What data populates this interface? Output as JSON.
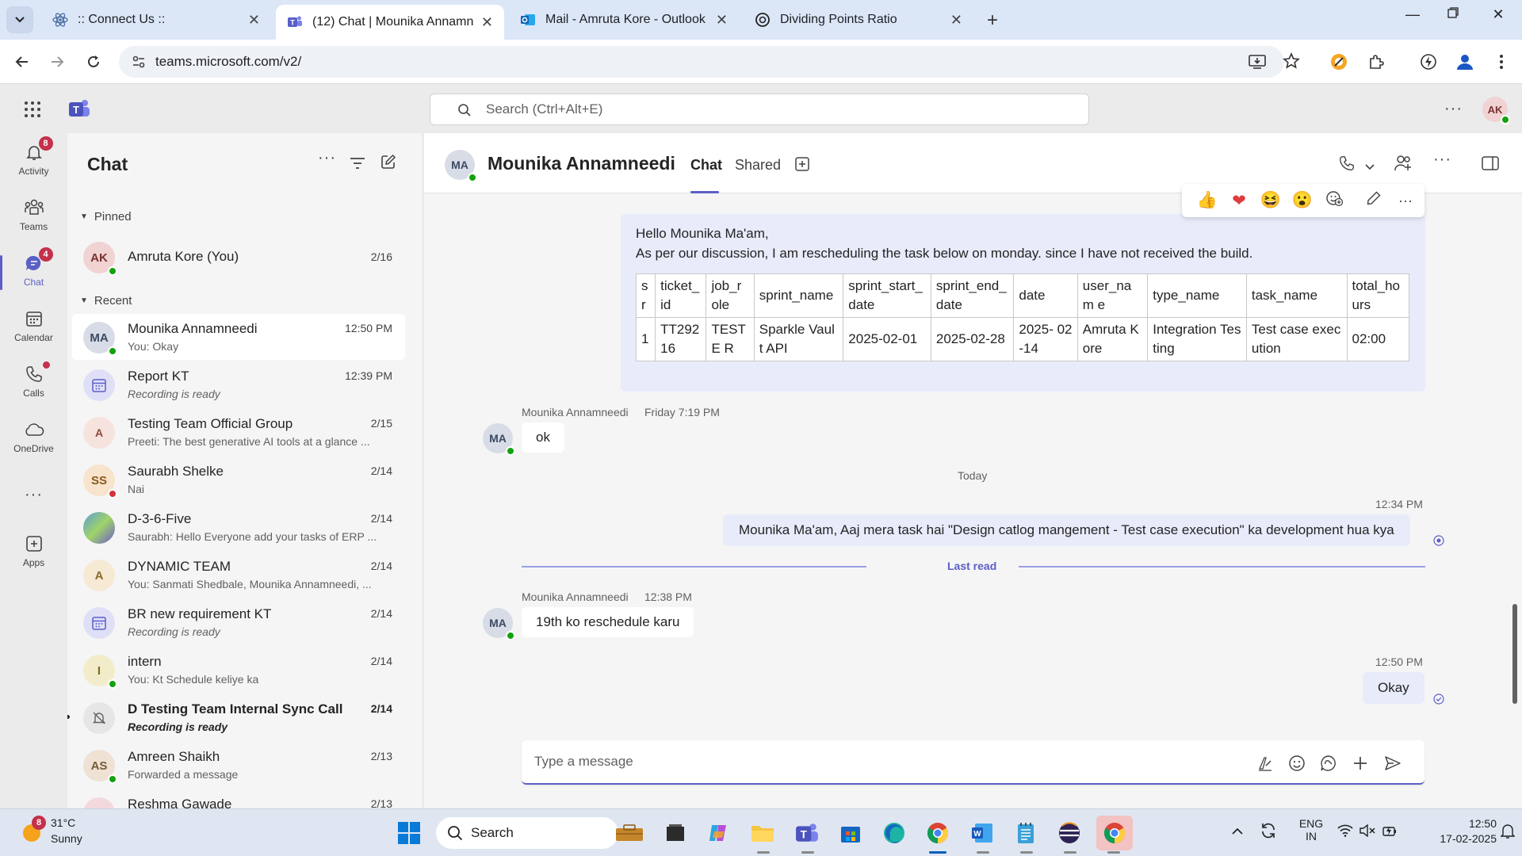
{
  "browser": {
    "tabs": [
      {
        "title": ":: Connect Us ::",
        "active": false
      },
      {
        "title": "(12) Chat | Mounika Annamneedi",
        "active": true
      },
      {
        "title": "Mail - Amruta Kore - Outlook",
        "active": false
      },
      {
        "title": "Dividing Points Ratio",
        "active": false
      }
    ],
    "url": "teams.microsoft.com/v2/"
  },
  "teams": {
    "search_placeholder": "Search (Ctrl+Alt+E)",
    "user_initials": "AK",
    "appbar": [
      {
        "label": "Activity",
        "badge": "8"
      },
      {
        "label": "Teams",
        "badge": ""
      },
      {
        "label": "Chat",
        "badge": "4"
      },
      {
        "label": "Calendar",
        "badge": ""
      },
      {
        "label": "Calls",
        "badge": ""
      },
      {
        "label": "OneDrive",
        "badge": ""
      },
      {
        "label": "Apps",
        "badge": ""
      }
    ]
  },
  "chatlist": {
    "title": "Chat",
    "pinned_label": "Pinned",
    "recent_label": "Recent",
    "pinned": [
      {
        "initials": "AK",
        "name": "Amruta Kore (You)",
        "time": "2/16"
      }
    ],
    "recent": [
      {
        "initials": "MA",
        "name": "Mounika Annamneedi",
        "preview": "You: Okay",
        "time": "12:50 PM"
      },
      {
        "initials": "",
        "name": "Report KT",
        "preview": "Recording is ready",
        "time": "12:39 PM"
      },
      {
        "initials": "A",
        "name": "Testing Team Official Group",
        "preview": "Preeti: The best generative AI tools at a glance  ...",
        "time": "2/15"
      },
      {
        "initials": "SS",
        "name": "Saurabh Shelke",
        "preview": "Nai",
        "time": "2/14"
      },
      {
        "initials": "",
        "name": "D-3-6-Five",
        "preview": "Saurabh: Hello Everyone add your tasks of ERP ...",
        "time": "2/14"
      },
      {
        "initials": "A",
        "name": "DYNAMIC TEAM",
        "preview": "You: Sanmati Shedbale, Mounika Annamneedi, ...",
        "time": "2/14"
      },
      {
        "initials": "",
        "name": "BR new requirement KT",
        "preview": "Recording is ready",
        "time": "2/14"
      },
      {
        "initials": "I",
        "name": "intern",
        "preview": "You: Kt Schedule keliye ka",
        "time": "2/14"
      },
      {
        "initials": "",
        "name": "D Testing Team Internal Sync Call",
        "preview": "Recording is ready",
        "time": "2/14"
      },
      {
        "initials": "AS",
        "name": "Amreen Shaikh",
        "preview": "Forwarded a message",
        "time": "2/13"
      },
      {
        "initials": "",
        "name": "Reshma Gawade",
        "preview": "",
        "time": "2/13"
      }
    ]
  },
  "conversation": {
    "initials": "MA",
    "name": "Mounika Annamneedi",
    "tab_chat": "Chat",
    "tab_shared": "Shared",
    "msg1_line1": "Hello Mounika Ma'am,",
    "msg1_line2": "As per our discussion, I am rescheduling the task below on monday. since I have not received the build.",
    "table": {
      "headers": [
        "s r",
        "ticket_ id",
        "job_r ole",
        "sprint_name",
        "sprint_start_ date",
        "sprint_end_ date",
        "date",
        "user_nam e",
        "type_name",
        "task_name",
        "total_ho urs"
      ],
      "row": [
        "1",
        "TT292 16",
        "TESTE R",
        "Sparkle Vault API",
        "2025-02-01",
        "2025-02-28",
        "2025- 02-14",
        "Amruta Kore",
        "Integration Testing",
        "Test case execution",
        "02:00"
      ]
    },
    "msg2_meta_name": "Mounika Annamneedi",
    "msg2_meta_time": "Friday 7:19 PM",
    "msg2_text": "ok",
    "day_divider": "Today",
    "msg3_time": "12:34 PM",
    "msg3_text": "Mounika Ma'am, Aaj mera task hai \"Design catlog mangement - Test case execution\" ka development hua kya",
    "last_read": "Last read",
    "msg4_meta_name": "Mounika Annamneedi",
    "msg4_meta_time": "12:38 PM",
    "msg4_text": "19th ko reschedule karu",
    "msg5_time": "12:50 PM",
    "msg5_text": "Okay",
    "composer_placeholder": "Type a message"
  },
  "taskbar": {
    "weather_badge": "8",
    "temperature": "31°C",
    "condition": "Sunny",
    "search_label": "Search",
    "lang1": "ENG",
    "lang2": "IN",
    "time": "12:50",
    "date": "17-02-2025"
  }
}
